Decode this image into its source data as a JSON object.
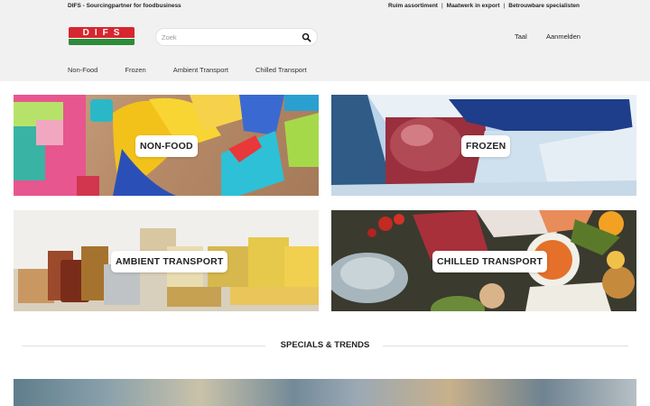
{
  "topbar": {
    "tagline": "DIFS - Sourcingpartner for foodbusiness",
    "usps": [
      "Ruim assortiment",
      "Maatwerk in export",
      "Betrouwbare specialisten"
    ],
    "separator": "|"
  },
  "logo": {
    "text": "DIFS"
  },
  "search": {
    "placeholder": "Zoek",
    "value": ""
  },
  "header": {
    "language_label": "Taal",
    "login_label": "Aanmelden"
  },
  "nav": {
    "items": [
      "Non-Food",
      "Frozen",
      "Ambient Transport",
      "Chilled Transport"
    ]
  },
  "categories": [
    {
      "label": "NON-FOOD"
    },
    {
      "label": "FROZEN"
    },
    {
      "label": "AMBIENT TRANSPORT"
    },
    {
      "label": "CHILLED TRANSPORT"
    }
  ],
  "specials": {
    "title": "SPECIALS & TRENDS"
  },
  "colors": {
    "brand_red": "#d6262f",
    "brand_green": "#2e8b3a",
    "header_bg": "#f1f1f1"
  }
}
